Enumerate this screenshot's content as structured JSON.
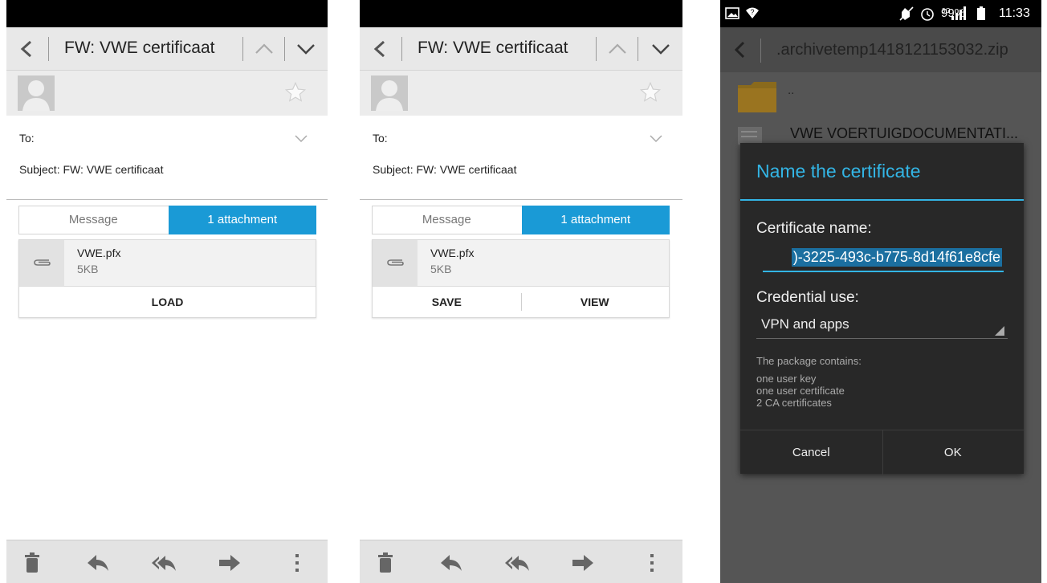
{
  "email": {
    "title": "FW: VWE certificaat",
    "to_label": "To:",
    "subject_line": "Subject:  FW: VWE certificaat",
    "tabs": {
      "message": "Message",
      "attachments": "1 attachment"
    },
    "attachment": {
      "name": "VWE.pfx",
      "size": "5KB"
    },
    "accent_color": "#1a9ad6"
  },
  "screen1": {
    "load_button": "LOAD"
  },
  "screen2": {
    "save_button": "SAVE",
    "view_button": "VIEW"
  },
  "bottom_bar_icons": [
    "trash-icon",
    "reply-icon",
    "reply-all-icon",
    "forward-icon",
    "overflow-menu-icon"
  ],
  "screen3": {
    "status_bar": {
      "battery": "99%",
      "time": "11:33",
      "network": "3G"
    },
    "file_manager": {
      "title": ".archivetemp1418121153032.zip",
      "parent_entry": "..",
      "file_entry": "VWE VOERTUIGDOCUMENTATI..."
    },
    "dialog": {
      "title": "Name the certificate",
      "certificate_name_label": "Certificate name:",
      "certificate_name_value": ")-3225-493c-b775-8d14f61e8cfe",
      "credential_use_label": "Credential use:",
      "credential_use_value": "VPN and apps",
      "package_heading": "The package contains:",
      "package_items": [
        "one user key",
        "one user certificate",
        "2 CA certificates"
      ],
      "cancel_button": "Cancel",
      "ok_button": "OK",
      "accent_color": "#33b5e5"
    }
  }
}
